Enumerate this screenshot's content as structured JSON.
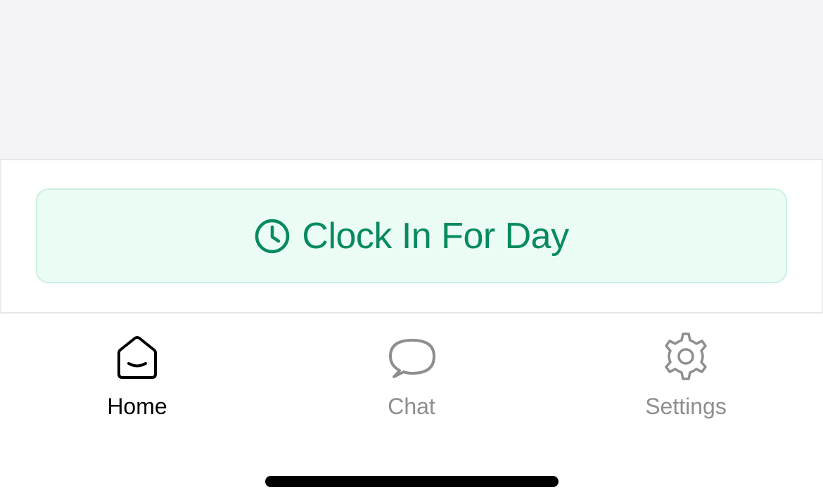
{
  "action": {
    "clock_in_label": "Clock In For Day",
    "icon": "clock-icon",
    "text_color": "#078a5f",
    "background_color": "#eafcf4",
    "border_color": "#c9f2de"
  },
  "tabbar": {
    "tabs": [
      {
        "id": "home",
        "label": "Home",
        "icon": "home-icon",
        "active": true
      },
      {
        "id": "chat",
        "label": "Chat",
        "icon": "chat-bubble-icon",
        "active": false
      },
      {
        "id": "settings",
        "label": "Settings",
        "icon": "gear-icon",
        "active": false
      }
    ],
    "active_color": "#000000",
    "inactive_color": "#8e8e92"
  }
}
